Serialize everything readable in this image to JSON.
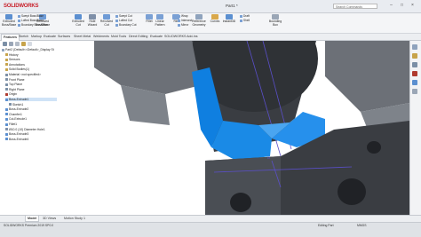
{
  "app": {
    "logo_text": "SOLIDWORKS",
    "document_title": "Part1 *",
    "search_placeholder": "Search Commands"
  },
  "window_controls": {
    "minimize": "–",
    "maximize": "□",
    "close": "×"
  },
  "ribbon": {
    "large": [
      {
        "label": "Extruded Boss/Base",
        "color": "#5b8fd0"
      },
      {
        "label": "Revolved Boss/Base",
        "color": "#6e9bd6"
      },
      {
        "label": "Extruded Cut",
        "color": "#5b8fd0"
      },
      {
        "label": "Hole Wizard",
        "color": "#7e8fa8"
      },
      {
        "label": "Revolved Cut",
        "color": "#6e9bd6"
      },
      {
        "label": "Fillet",
        "color": "#7aa0d4"
      },
      {
        "label": "Linear Pattern",
        "color": "#7aa0d4"
      },
      {
        "label": "Rib",
        "color": "#7aa0d4"
      },
      {
        "label": "Reference Geometry",
        "color": "#8fa3bd"
      },
      {
        "label": "Curves",
        "color": "#d9a84b"
      },
      {
        "label": "Instant3D",
        "color": "#5b8fd0"
      },
      {
        "label": "Bounding Box",
        "color": "#9aa6b6"
      }
    ],
    "small_col1": [
      "Swept Boss/Base",
      "Lofted Boss/Base",
      "Boundary Boss/Base"
    ],
    "small_col2": [
      "Swept Cut",
      "Lofted Cut",
      "Boundary Cut"
    ],
    "small_col3": [
      "Wrap",
      "Intersect",
      "Mirror"
    ],
    "small_col4": [
      "Draft",
      "Shell"
    ]
  },
  "tabs": [
    "Features",
    "Sketch",
    "Markup",
    "Evaluate",
    "Surfaces",
    "Sheet Metal",
    "Weldments",
    "Mold Tools",
    "Direct Editing",
    "Evaluate",
    "SOLIDWORKS Add-Ins"
  ],
  "tree": [
    {
      "label": "Part2 (Default<<Default>_Display St",
      "icon": "#8fa3bd",
      "indent": 0,
      "selected": false
    },
    {
      "label": "History",
      "icon": "#c7a34a",
      "indent": 1,
      "selected": false
    },
    {
      "label": "Sensors",
      "icon": "#c7a34a",
      "indent": 1,
      "selected": false
    },
    {
      "label": "Annotations",
      "icon": "#c7a34a",
      "indent": 1,
      "selected": false
    },
    {
      "label": "Solid Bodies(1)",
      "icon": "#c7a34a",
      "indent": 1,
      "selected": false
    },
    {
      "label": "Material <not specified>",
      "icon": "#7b8fa6",
      "indent": 1,
      "selected": false
    },
    {
      "label": "Front Plane",
      "icon": "#7b8fa6",
      "indent": 1,
      "selected": false
    },
    {
      "label": "Top Plane",
      "icon": "#7b8fa6",
      "indent": 1,
      "selected": false
    },
    {
      "label": "Right Plane",
      "icon": "#7b8fa6",
      "indent": 1,
      "selected": false
    },
    {
      "label": "Origin",
      "icon": "#b03a2e",
      "indent": 1,
      "selected": false
    },
    {
      "label": "Boss-Extrude1",
      "icon": "#5b8fd0",
      "indent": 1,
      "selected": true
    },
    {
      "label": "Sketch1",
      "icon": "#7b8fa6",
      "indent": 2,
      "selected": false
    },
    {
      "label": "Boss-Extrude2",
      "icon": "#5b8fd0",
      "indent": 1,
      "selected": false
    },
    {
      "label": "Chamfer1",
      "icon": "#5b8fd0",
      "indent": 1,
      "selected": false
    },
    {
      "label": "Cut-Extrude1",
      "icon": "#5b8fd0",
      "indent": 1,
      "selected": false
    },
    {
      "label": "Fillet1",
      "icon": "#5b8fd0",
      "indent": 1,
      "selected": false
    },
    {
      "label": "Ø10.0 (10) Diameter Hole1",
      "icon": "#7e8fa8",
      "indent": 1,
      "selected": false
    },
    {
      "label": "Boss-Extrude3",
      "icon": "#5b8fd0",
      "indent": 1,
      "selected": false
    },
    {
      "label": "Boss-Extrude4",
      "icon": "#5b8fd0",
      "indent": 1,
      "selected": false
    }
  ],
  "bottom_tabs": [
    "Model",
    "3D Views",
    "Motion Study 1"
  ],
  "status": {
    "left": "SOLIDWORKS Premium 2019 SP0.0",
    "mid": "Editing Part",
    "right": "MMGS"
  },
  "colors": {
    "selection_blue": "#1a6fd8",
    "face_blue": "#0f7fe0",
    "body_gray": "#6c7077",
    "body_dark": "#3a3d42",
    "sketch_line": "#5a4fc9"
  }
}
